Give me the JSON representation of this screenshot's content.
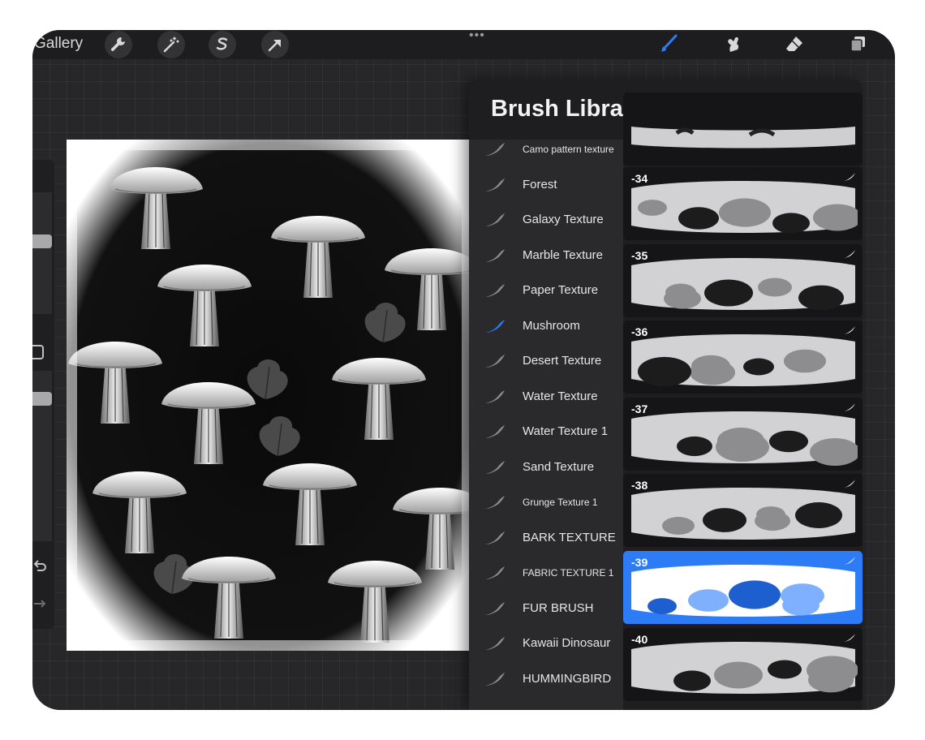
{
  "toolbar": {
    "gallery_label": "Gallery",
    "grabber": "•••",
    "left_tools": [
      "wrench-icon",
      "magic-wand-icon",
      "selection-s-icon",
      "arrow-icon"
    ],
    "right_tools": [
      "brush-icon",
      "smudge-icon",
      "eraser-icon",
      "layers-icon"
    ],
    "accent_color": "#2d7cf6"
  },
  "brush_library": {
    "title": "Brush Library",
    "add_icon": "plus-icon",
    "categories": [
      {
        "label": "Camo pattern texture",
        "active": false
      },
      {
        "label": "Forest",
        "active": false
      },
      {
        "label": "Galaxy Texture",
        "active": false
      },
      {
        "label": "Marble Texture",
        "active": false
      },
      {
        "label": "Paper Texture",
        "active": false
      },
      {
        "label": "Mushroom",
        "active": true
      },
      {
        "label": "Desert Texture",
        "active": false
      },
      {
        "label": "Water Texture",
        "active": false
      },
      {
        "label": "Water Texture 1",
        "active": false
      },
      {
        "label": "Sand Texture",
        "active": false
      },
      {
        "label": "Grunge Texture 1",
        "active": false
      },
      {
        "label": "BARK TEXTURE",
        "active": false
      },
      {
        "label": "FABRIC TEXTURE 1",
        "active": false
      },
      {
        "label": "FUR BRUSH",
        "active": false
      },
      {
        "label": "Kawaii Dinosaur",
        "active": false
      },
      {
        "label": "HUMMINGBIRD",
        "active": false
      }
    ],
    "brushes": [
      {
        "number": "-34",
        "selected": false
      },
      {
        "number": "-35",
        "selected": false
      },
      {
        "number": "-36",
        "selected": false
      },
      {
        "number": "-37",
        "selected": false
      },
      {
        "number": "-38",
        "selected": false
      },
      {
        "number": "-39",
        "selected": true
      },
      {
        "number": "-40",
        "selected": false
      }
    ]
  }
}
